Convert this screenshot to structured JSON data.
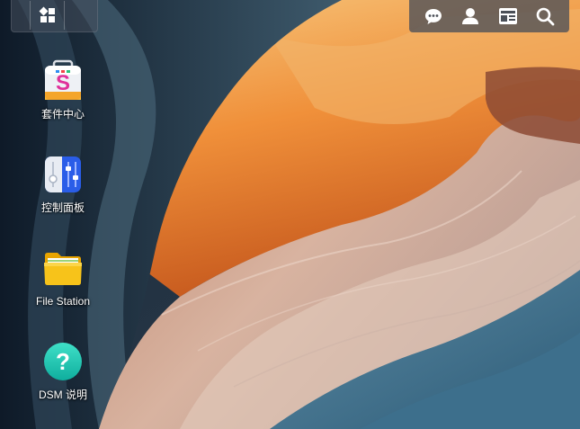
{
  "desktop": {
    "icons": [
      {
        "label": "套件中心",
        "icon": "package-center-icon"
      },
      {
        "label": "控制面板",
        "icon": "control-panel-icon"
      },
      {
        "label": "File Station",
        "icon": "file-station-icon"
      },
      {
        "label": "DSM 说明",
        "icon": "dsm-help-icon"
      }
    ]
  },
  "taskbar": {
    "main_menu_icon": "main-menu-icon",
    "tray": [
      "chat-icon",
      "user-icon",
      "widgets-icon",
      "search-icon"
    ]
  },
  "colors": {
    "taskbar_bg": "#4b5058",
    "label_text": "#ffffff",
    "help_icon": "#1ec8b4",
    "folder_icon": "#f7b500",
    "control_panel_icon": "#2a5de8"
  }
}
